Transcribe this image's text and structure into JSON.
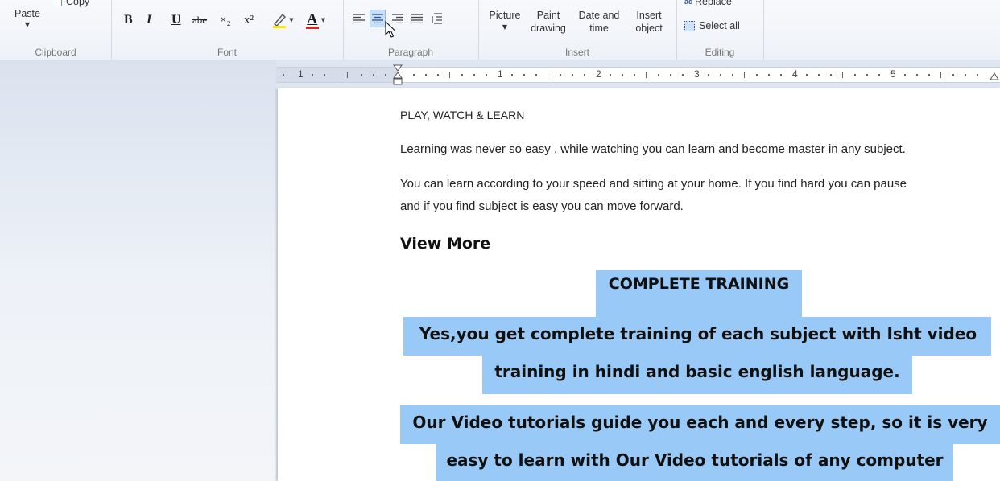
{
  "ribbon": {
    "clipboard": {
      "label": "Clipboard",
      "paste_label": "Paste",
      "copy_label": "Copy"
    },
    "font": {
      "label": "Font",
      "buttons": [
        "B",
        "I",
        "U",
        "abe",
        "×₂",
        "x²"
      ],
      "font_color_letter": "A",
      "font_color": "#d6281e",
      "highlight_color": "#ffe600"
    },
    "paragraph": {
      "label": "Paragraph"
    },
    "insert": {
      "label": "Insert",
      "picture_label": "Picture",
      "paint_label_1": "Paint",
      "paint_label_2": "drawing",
      "datetime_label_1": "Date and",
      "datetime_label_2": "time",
      "object_label_1": "Insert",
      "object_label_2": "object"
    },
    "editing": {
      "label": "Editing",
      "replace_label": "Replace",
      "select_all_label": "Select all"
    }
  },
  "ruler": {
    "numbers": [
      "1",
      "1",
      "2",
      "3",
      "4",
      "5"
    ]
  },
  "document": {
    "heading_caps": "PLAY, WATCH & LEARN",
    "para1": "Learning was never so easy , while watching you can learn and become master in any subject.",
    "para2_line1": "You can learn according to your speed and sitting at your home. If you find hard you can pause",
    "para2_line2": "and if you find subject is easy you can move forward.",
    "view_more": "View More",
    "complete_training": "COMPLETE TRAINING",
    "yes_line1": "Yes,you get complete training of each subject with Isht video",
    "yes_line2": "training in hindi and basic english language.",
    "our_line1": "Our Video tutorials guide you each and every step, so it is very",
    "our_line2": "easy to learn with Our Video tutorials of any computer"
  },
  "colors": {
    "selection": "#99c9f7",
    "accent": "#2b5797"
  }
}
